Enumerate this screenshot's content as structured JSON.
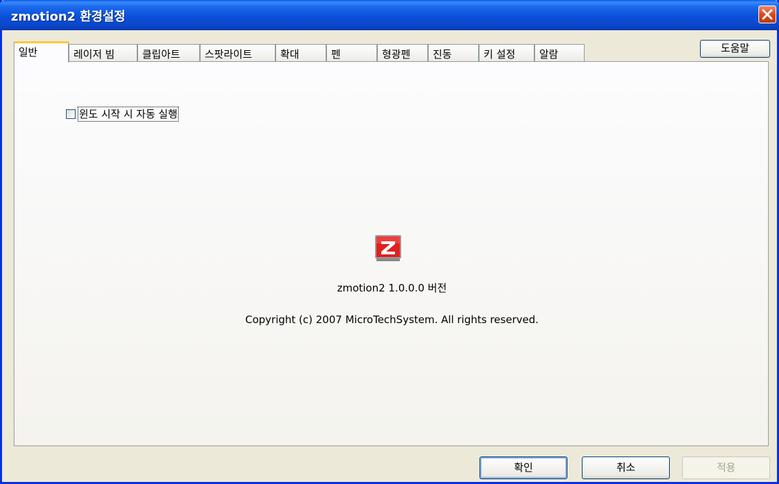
{
  "window": {
    "title": "zmotion2 환경설정"
  },
  "tabs": [
    {
      "label": "일반"
    },
    {
      "label": "레이저 빔"
    },
    {
      "label": "클립아트"
    },
    {
      "label": "스팟라이트"
    },
    {
      "label": "확대"
    },
    {
      "label": "펜"
    },
    {
      "label": "형광펜"
    },
    {
      "label": "진동"
    },
    {
      "label": "키 설정"
    },
    {
      "label": "알람"
    }
  ],
  "active_tab": "일반",
  "help_button": "도움말",
  "general": {
    "autostart_label": "윈도 시작 시 자동 실행",
    "autostart_checked": false,
    "version_text": "zmotion2 1.0.0.0 버전",
    "copyright_text": "Copyright (c) 2007 MicroTechSystem. All rights reserved."
  },
  "buttons": {
    "ok": "확인",
    "cancel": "취소",
    "apply": "적용"
  },
  "colors": {
    "titlebar": "#0a47cc",
    "close": "#d9491b",
    "active_tab_accent": "#ffc83c",
    "logo": "#e02020"
  },
  "icons": {
    "logo": "zmotion-logo-icon",
    "close": "close-icon"
  }
}
